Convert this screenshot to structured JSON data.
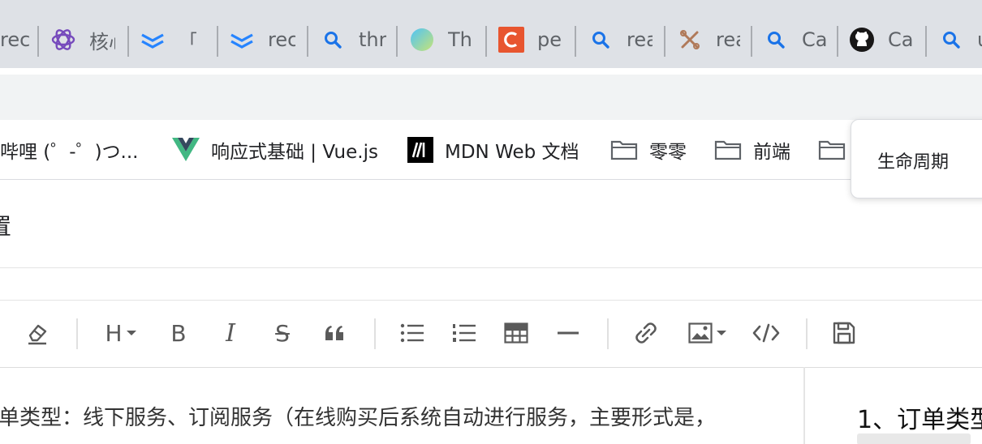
{
  "browser": {
    "tabs": [
      {
        "label": "rec",
        "icon": "none-icon"
      },
      {
        "label": "核心",
        "icon": "redux-icon"
      },
      {
        "label": "「F",
        "icon": "confluence-icon"
      },
      {
        "label": "rec",
        "icon": "confluence-icon"
      },
      {
        "label": "thr",
        "icon": "search-icon"
      },
      {
        "label": "Th",
        "icon": "sphere-icon"
      },
      {
        "label": "pe",
        "icon": "c-logo-icon"
      },
      {
        "label": "rea",
        "icon": "search-icon"
      },
      {
        "label": "rea",
        "icon": "tools-icon"
      },
      {
        "label": "Ca",
        "icon": "search-icon"
      },
      {
        "label": "Ca",
        "icon": "github-icon"
      },
      {
        "label": "u",
        "icon": "search-icon"
      }
    ]
  },
  "bookmarks": [
    {
      "label": "哔哩哔哩 (゜-゜)つ...",
      "icon": "bilibili-icon"
    },
    {
      "label": "响应式基础 | Vue.js",
      "icon": "vue-icon"
    },
    {
      "label": "MDN Web 文档",
      "icon": "mdn-icon"
    },
    {
      "label": "零零",
      "icon": "folder-icon"
    },
    {
      "label": "前端",
      "icon": "folder-icon"
    },
    {
      "label": "",
      "icon": "folder-icon"
    }
  ],
  "popup": {
    "label": "生命周期"
  },
  "document": {
    "title": "置"
  },
  "toolbar": {
    "items": [
      "eraser-icon",
      "heading-icon",
      "bold-icon",
      "italic-icon",
      "strikethrough-icon",
      "quote-icon",
      "bullet-list-icon",
      "ordered-list-icon",
      "table-icon",
      "horizontal-rule-icon",
      "link-icon",
      "image-icon",
      "code-icon",
      "save-icon"
    ],
    "heading_label": "H",
    "bold_label": "B",
    "italic_label": "I",
    "strike_label": "S"
  },
  "editor": {
    "line1": "单类型：线下服务、订阅服务（在线购买后系统自动进行服务，主要形式是，"
  },
  "preview": {
    "line1": "1、订单类型"
  },
  "colors": {
    "accent_blue": "#1a73e8",
    "tabbar": "#dee1e6",
    "vue_green": "#42b883",
    "c_orange": "#e8552f"
  }
}
